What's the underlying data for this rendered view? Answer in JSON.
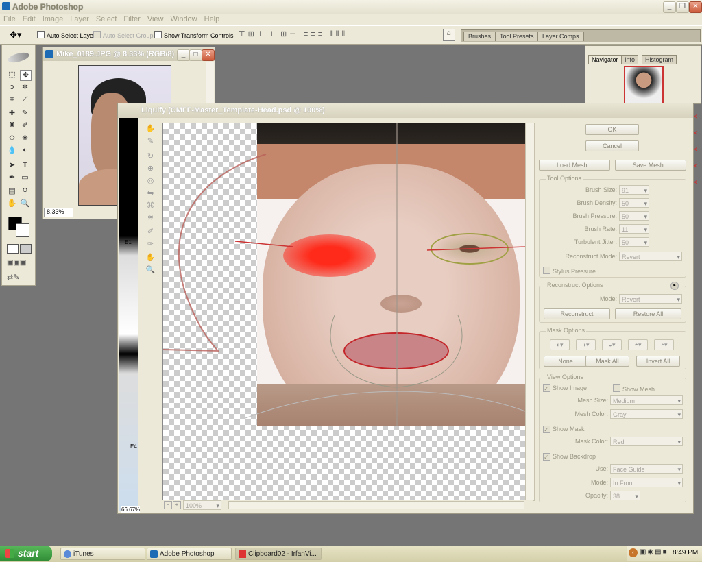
{
  "app": {
    "title": "Adobe Photoshop"
  },
  "menu": [
    "File",
    "Edit",
    "Image",
    "Layer",
    "Select",
    "Filter",
    "View",
    "Window",
    "Help"
  ],
  "options": {
    "auto_select_layer": "Auto Select Layer",
    "auto_select_groups": "Auto Select Groups",
    "show_transform": "Show Transform Controls"
  },
  "palette_tabs": [
    "Brushes",
    "Tool Presets",
    "Layer Comps"
  ],
  "document": {
    "title": "Mike_0189.JPG @ 8.33% (RGB/8)",
    "zoom": "8.33%"
  },
  "navigator": {
    "tabs": [
      "Navigator",
      "Info",
      "Histogram"
    ]
  },
  "liquify": {
    "title": "Liquify (CMFF-Master_Template-Head.psd @ 100%)",
    "ok": "OK",
    "cancel": "Cancel",
    "load_mesh": "Load Mesh...",
    "save_mesh": "Save Mesh...",
    "tool_options": {
      "title": "Tool Options",
      "rows": [
        {
          "label": "Brush Size:",
          "value": "91"
        },
        {
          "label": "Brush Density:",
          "value": "50"
        },
        {
          "label": "Brush Pressure:",
          "value": "50"
        },
        {
          "label": "Brush Rate:",
          "value": "11"
        },
        {
          "label": "Turbulent Jitter:",
          "value": "50"
        }
      ],
      "reconstruct_mode_label": "Reconstruct Mode:",
      "reconstruct_mode": "Revert",
      "stylus": "Stylus Pressure"
    },
    "reconstruct": {
      "title": "Reconstruct Options",
      "mode_label": "Mode:",
      "mode": "Revert",
      "reconstruct": "Reconstruct",
      "restore_all": "Restore All"
    },
    "mask": {
      "title": "Mask Options",
      "none": "None",
      "mask_all": "Mask All",
      "invert_all": "Invert All"
    },
    "view": {
      "title": "View Options",
      "show_image": "Show Image",
      "show_mesh": "Show Mesh",
      "mesh_size_label": "Mesh Size:",
      "mesh_size": "Medium",
      "mesh_color_label": "Mesh Color:",
      "mesh_color": "Gray",
      "show_mask": "Show Mask",
      "mask_color_label": "Mask Color:",
      "mask_color": "Red",
      "show_backdrop": "Show Backdrop",
      "use_label": "Use:",
      "use": "Face Guide",
      "mode_label": "Mode:",
      "mode": "In Front",
      "opacity_label": "Opacity:",
      "opacity": "38"
    },
    "zoom": "100%",
    "behind_labels": {
      "e1": "E1",
      "e4": "E4",
      "zoom": "66.67%"
    }
  },
  "taskbar": {
    "start": "start",
    "tasks": [
      "iTunes",
      "Adobe Photoshop",
      "Clipboard02 - IrfanVi..."
    ],
    "clock": "8:49 PM"
  }
}
